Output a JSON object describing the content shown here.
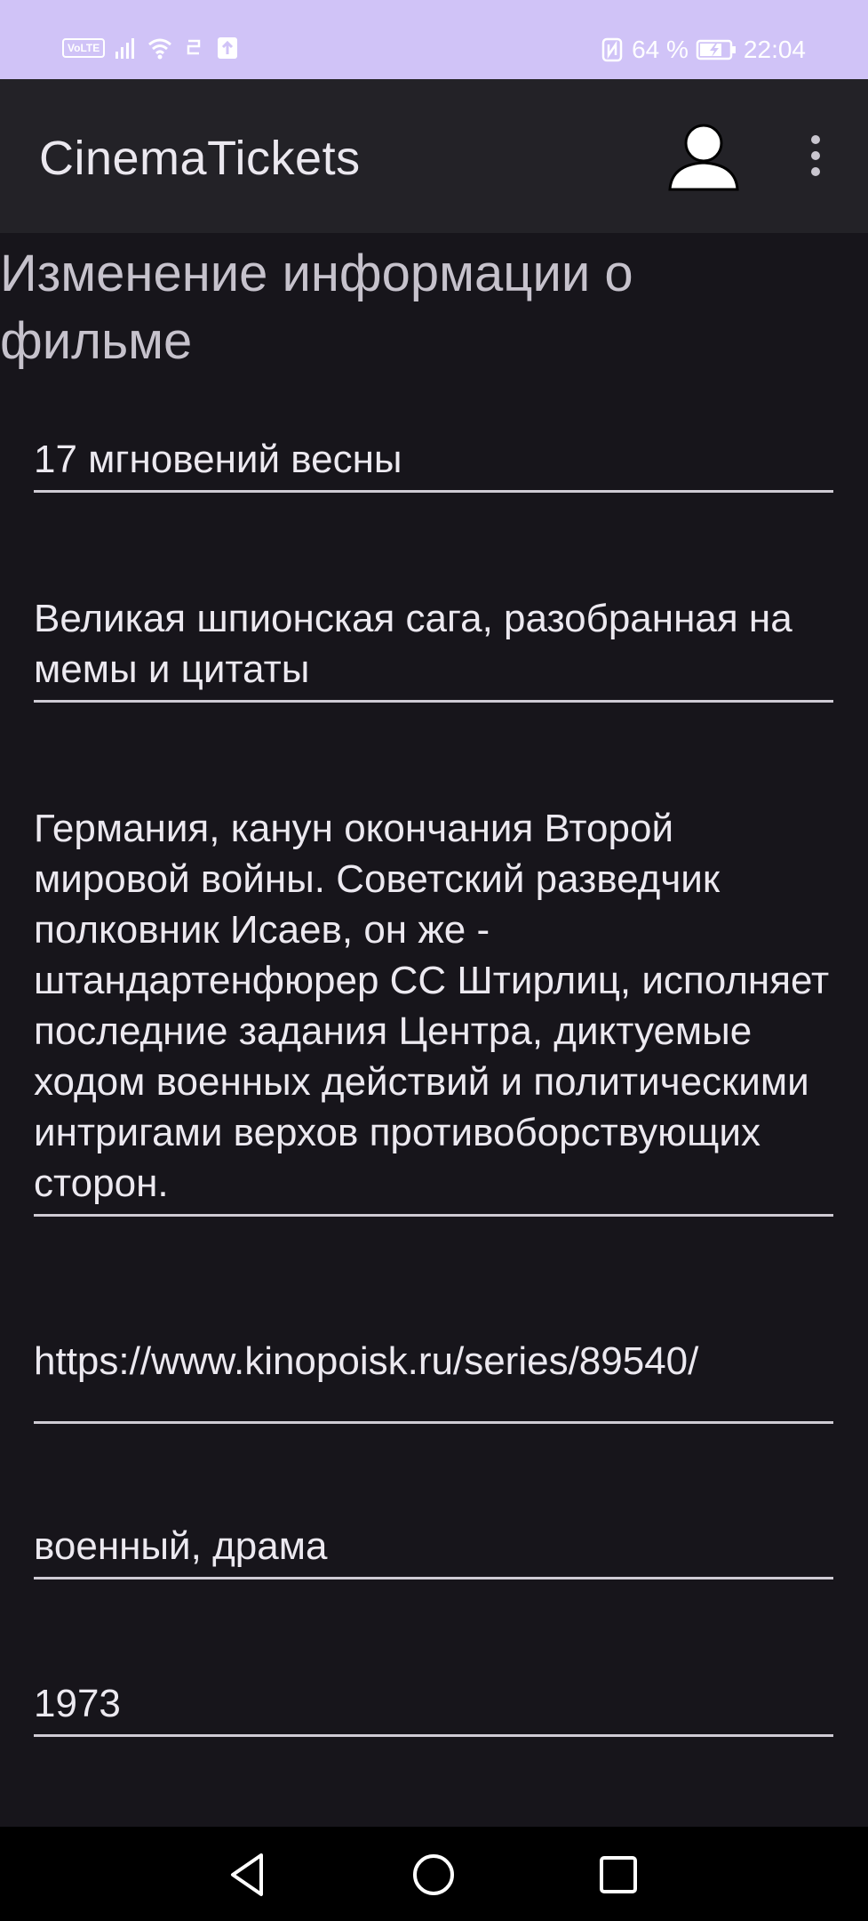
{
  "status_bar": {
    "volte": "VoLTE",
    "battery": "64 %",
    "time": "22:04"
  },
  "app_bar": {
    "title": "CinemaTickets"
  },
  "page": {
    "heading": "Изменение информации о фильме"
  },
  "form": {
    "title": "17 мгновений весны",
    "tagline": "Великая шпионская сага, разобранная на мемы и цитаты",
    "description": "Германия, канун окончания Второй мировой войны. Советский разведчик полковник Исаев, он же - штандартенфюрер СС Штирлиц, исполняет последние задания Центра, диктуемые ходом военных действий и политическими интригами верхов противоборствующих сторон.",
    "url": "https://www.kinopoisk.ru/series/89540/",
    "genres": "военный, драма",
    "year": "1973"
  },
  "icons": {
    "profile": "person-icon",
    "more": "more-vert-icon",
    "nav_back": "back-triangle-icon",
    "nav_home": "home-circle-icon",
    "nav_recents": "recents-square-icon"
  },
  "colors": {
    "status_bar": "#d0c3f7",
    "app_bar": "#232227",
    "background": "#17151b",
    "text": "#ece9f0"
  }
}
